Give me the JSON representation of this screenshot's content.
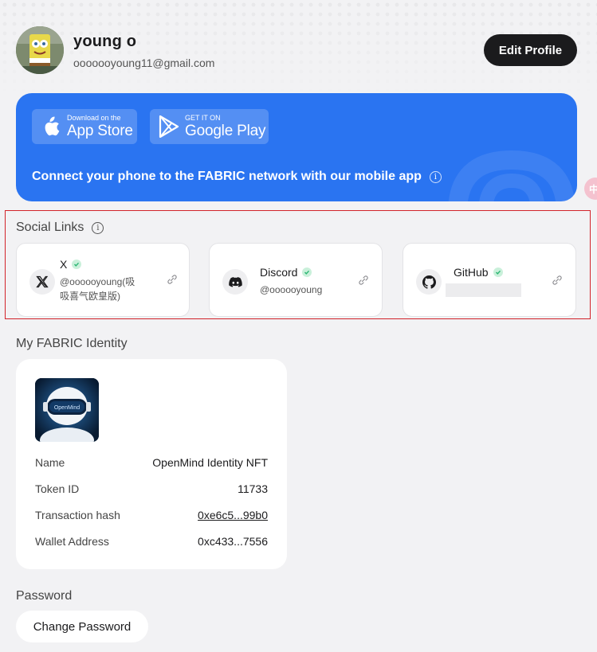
{
  "profile": {
    "name": "young o",
    "email": "ooooooyoung11@gmail.com",
    "edit_label": "Edit Profile"
  },
  "banner": {
    "app_store_small": "Download on the",
    "app_store_big": "App Store",
    "google_play_small": "GET IT ON",
    "google_play_big": "Google Play",
    "text": "Connect your phone to the FABRIC network with our mobile app",
    "color": "#2a74f1"
  },
  "side_badge": "中",
  "social": {
    "title": "Social Links",
    "links": [
      {
        "name": "X",
        "handle": "@oooooyoung(吸吸喜气欧皇版)",
        "icon": "x-logo-icon",
        "verified": true
      },
      {
        "name": "Discord",
        "handle": "@oooooyoung",
        "icon": "discord-icon",
        "verified": true
      },
      {
        "name": "GitHub",
        "handle": "",
        "icon": "github-icon",
        "verified": true
      }
    ]
  },
  "identity": {
    "title": "My FABRIC Identity",
    "image_caption": "OpenMind",
    "rows": [
      {
        "label": "Name",
        "value": "OpenMind Identity NFT"
      },
      {
        "label": "Token ID",
        "value": "11733"
      },
      {
        "label": "Transaction hash",
        "value": "0xe6c5...99b0"
      },
      {
        "label": "Wallet Address",
        "value": "0xc433...7556"
      }
    ]
  },
  "password": {
    "title": "Password",
    "button": "Change Password"
  },
  "colors": {
    "highlight": "#d2232a",
    "verified_green": "#2bb673",
    "dark_button": "#1b1b1d"
  }
}
